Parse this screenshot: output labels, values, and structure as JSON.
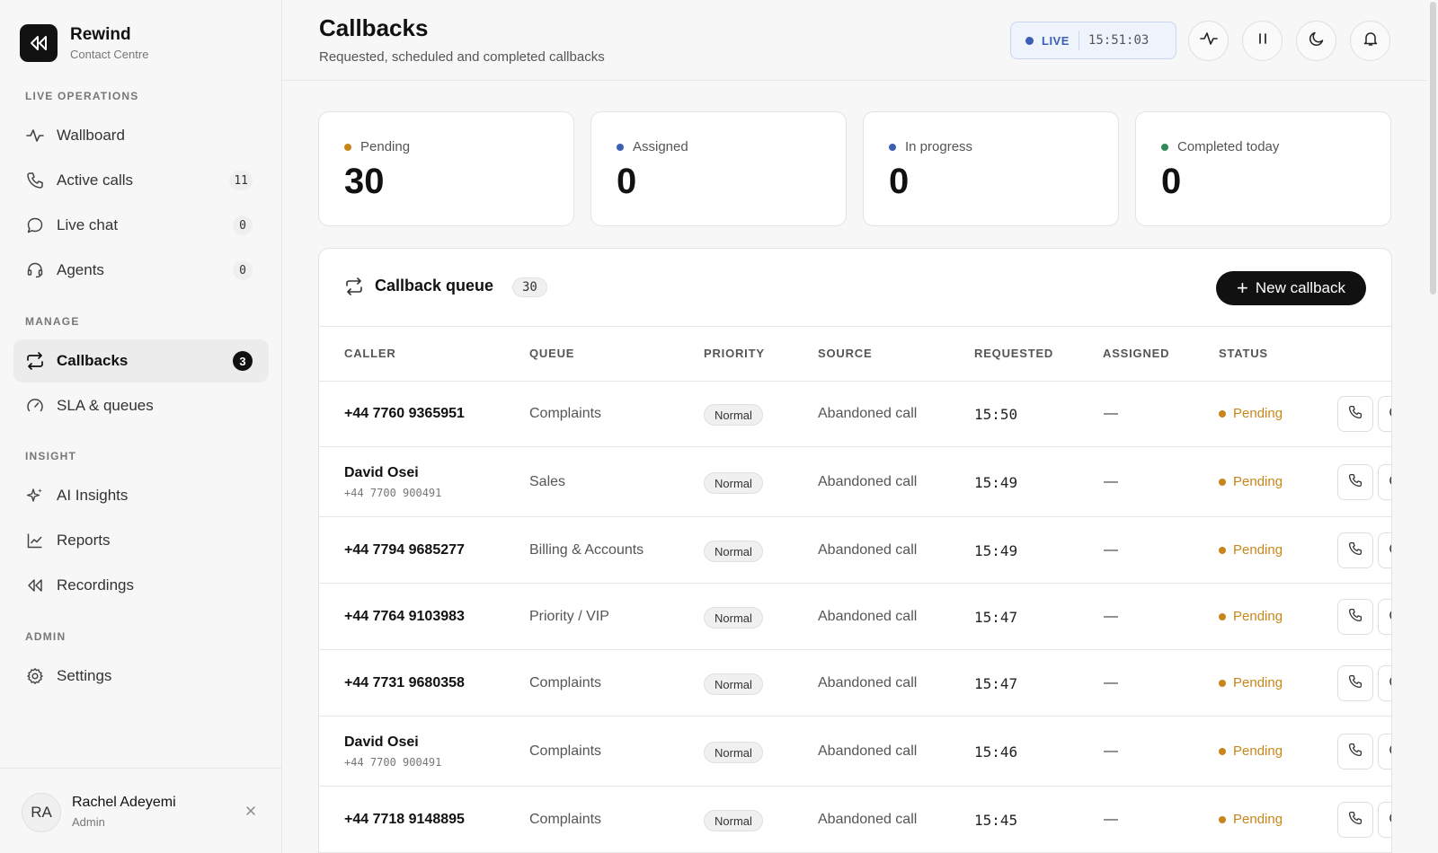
{
  "brand": {
    "name": "Rewind",
    "subtitle": "Contact Centre",
    "icon": "rewind-icon"
  },
  "sidebar": {
    "sections": [
      "LIVE OPERATIONS",
      "MANAGE",
      "INSIGHT",
      "ADMIN"
    ],
    "items": [
      {
        "label": "Wallboard",
        "icon": "pulse-icon",
        "badge": null
      },
      {
        "label": "Active calls",
        "icon": "phone-icon",
        "badge": "11"
      },
      {
        "label": "Live chat",
        "icon": "chat-icon",
        "badge": "0"
      },
      {
        "label": "Agents",
        "icon": "headset-icon",
        "badge": "0"
      },
      {
        "label": "Callbacks",
        "icon": "repeat-icon",
        "badge": "3",
        "active": true
      },
      {
        "label": "SLA & queues",
        "icon": "gauge-icon",
        "badge": null
      },
      {
        "label": "AI Insights",
        "icon": "sparkles-icon",
        "badge": null
      },
      {
        "label": "Reports",
        "icon": "chart-line-icon",
        "badge": null
      },
      {
        "label": "Recordings",
        "icon": "rewind-icon",
        "badge": null
      },
      {
        "label": "Settings",
        "icon": "gear-icon",
        "badge": null
      }
    ]
  },
  "user": {
    "initials": "RA",
    "name": "Rachel Adeyemi",
    "role": "Admin"
  },
  "header": {
    "title": "Callbacks",
    "subtitle": "Requested, scheduled and completed callbacks",
    "live_label": "LIVE",
    "clock": "15:51:03",
    "accent": "#3c5fb5"
  },
  "stats": [
    {
      "label": "Pending",
      "value": "30",
      "color": "#c8861a"
    },
    {
      "label": "Assigned",
      "value": "0",
      "color": "#3c5fb5"
    },
    {
      "label": "In progress",
      "value": "0",
      "color": "#3c5fb5"
    },
    {
      "label": "Completed today",
      "value": "0",
      "color": "#2e8b57"
    }
  ],
  "queue": {
    "title": "Callback queue",
    "count": "30",
    "new_button": "New callback",
    "columns": [
      "CALLER",
      "QUEUE",
      "PRIORITY",
      "SOURCE",
      "REQUESTED",
      "ASSIGNED",
      "STATUS"
    ],
    "rows": [
      {
        "caller": "+44 7760 9365951",
        "caller_sub": "",
        "queue": "Complaints",
        "priority": "Normal",
        "source": "Abandoned call",
        "requested": "15:50",
        "assigned": "—",
        "status": "Pending"
      },
      {
        "caller": "David Osei",
        "caller_sub": "+44 7700 900491",
        "queue": "Sales",
        "priority": "Normal",
        "source": "Abandoned call",
        "requested": "15:49",
        "assigned": "—",
        "status": "Pending"
      },
      {
        "caller": "+44 7794 9685277",
        "caller_sub": "",
        "queue": "Billing & Accounts",
        "priority": "Normal",
        "source": "Abandoned call",
        "requested": "15:49",
        "assigned": "—",
        "status": "Pending"
      },
      {
        "caller": "+44 7764 9103983",
        "caller_sub": "",
        "queue": "Priority / VIP",
        "priority": "Normal",
        "source": "Abandoned call",
        "requested": "15:47",
        "assigned": "—",
        "status": "Pending"
      },
      {
        "caller": "+44 7731 9680358",
        "caller_sub": "",
        "queue": "Complaints",
        "priority": "Normal",
        "source": "Abandoned call",
        "requested": "15:47",
        "assigned": "—",
        "status": "Pending"
      },
      {
        "caller": "David Osei",
        "caller_sub": "+44 7700 900491",
        "queue": "Complaints",
        "priority": "Normal",
        "source": "Abandoned call",
        "requested": "15:46",
        "assigned": "—",
        "status": "Pending"
      },
      {
        "caller": "+44 7718 9148895",
        "caller_sub": "",
        "queue": "Complaints",
        "priority": "Normal",
        "source": "Abandoned call",
        "requested": "15:45",
        "assigned": "—",
        "status": "Pending"
      }
    ]
  }
}
